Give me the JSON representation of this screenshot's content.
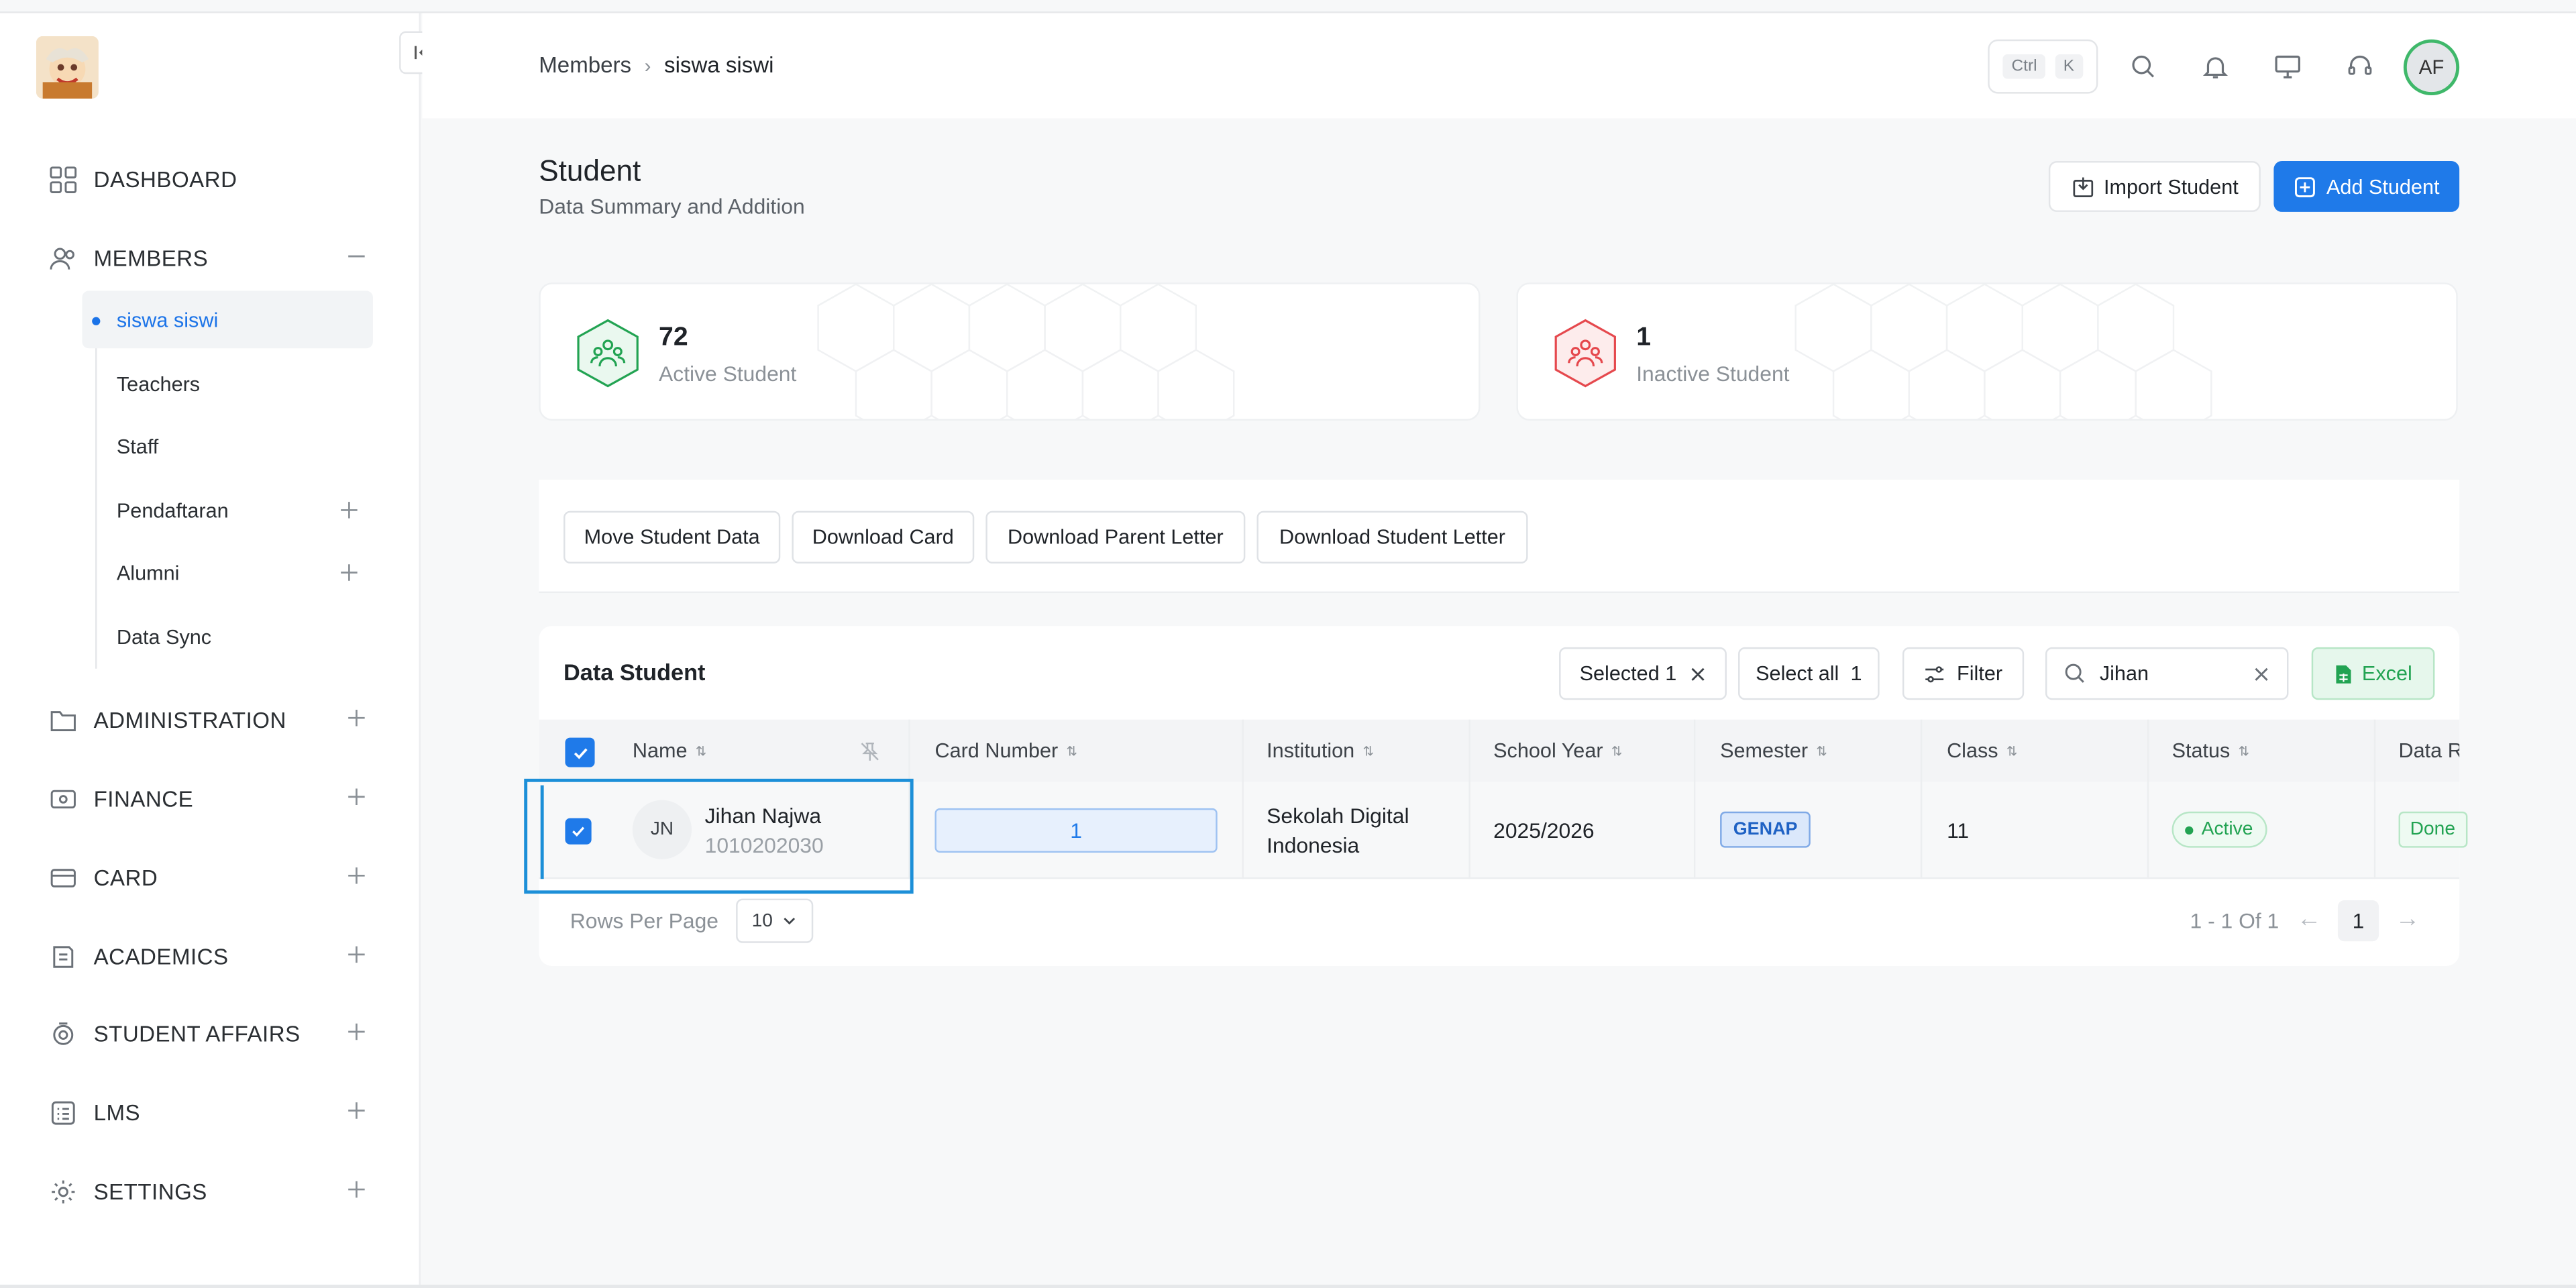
{
  "header": {
    "breadcrumb": [
      "Members",
      "siswa siswi"
    ],
    "kbd": [
      "Ctrl",
      "K"
    ],
    "avatar": "AF"
  },
  "sidebar": {
    "items": [
      {
        "label": "DASHBOARD",
        "icon": "dashboard-icon"
      },
      {
        "label": "MEMBERS",
        "icon": "users-icon"
      },
      {
        "label": "ADMINISTRATION",
        "icon": "folder-icon"
      },
      {
        "label": "FINANCE",
        "icon": "finance-icon"
      },
      {
        "label": "CARD",
        "icon": "card-icon"
      },
      {
        "label": "ACADEMICS",
        "icon": "academics-icon"
      },
      {
        "label": "STUDENT AFFAIRS",
        "icon": "student-affairs-icon"
      },
      {
        "label": "LMS",
        "icon": "lms-icon"
      },
      {
        "label": "SETTINGS",
        "icon": "gear-icon"
      }
    ],
    "members_sub": [
      "siswa siswi",
      "Teachers",
      "Staff",
      "Pendaftaran",
      "Alumni",
      "Data Sync"
    ]
  },
  "page": {
    "title": "Student",
    "subtitle": "Data Summary and Addition",
    "import_label": "Import Student",
    "add_label": "Add Student"
  },
  "stats": [
    {
      "value": "72",
      "label": "Active Student",
      "color": "#22a352"
    },
    {
      "value": "1",
      "label": "Inactive Student",
      "color": "#e5484d"
    }
  ],
  "actions": [
    "Move Student Data",
    "Download Card",
    "Download Parent Letter",
    "Download Student Letter"
  ],
  "table": {
    "title": "Data Student",
    "selected_label": "Selected 1",
    "select_all_label": "Select all",
    "select_all_count": "1",
    "filter_label": "Filter",
    "search_value": "Jihan",
    "excel_label": "Excel",
    "columns": [
      "Name",
      "Card Number",
      "Institution",
      "School Year",
      "Semester",
      "Class",
      "Status",
      "Data R"
    ],
    "rows": [
      {
        "initials": "JN",
        "name": "Jihan Najwa",
        "nis": "1010202030",
        "card_number": "1",
        "institution_line1": "Sekolah Digital",
        "institution_line2": "Indonesia",
        "school_year": "2025/2026",
        "semester": "GENAP",
        "class": "11",
        "status": "Active",
        "data_r": "Done"
      }
    ],
    "rows_per_page_label": "Rows Per Page",
    "rows_per_page": "10",
    "page_info": "1 - 1 Of 1",
    "current_page": "1"
  },
  "colors": {
    "accent": "#1f7ae9",
    "success": "#22a352",
    "danger": "#e5484d"
  }
}
